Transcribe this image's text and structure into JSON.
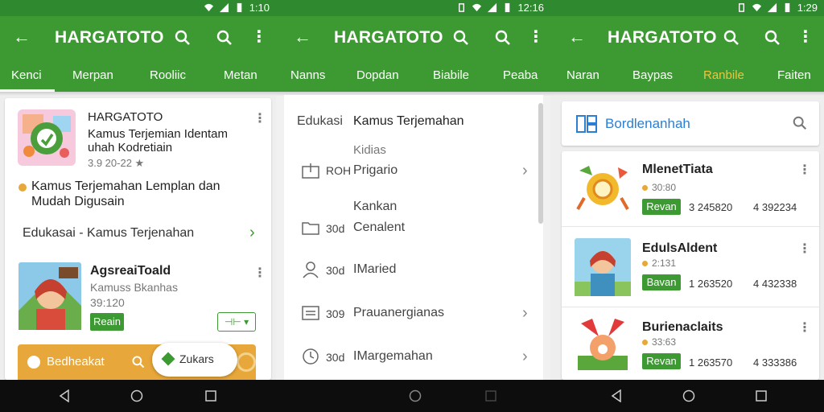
{
  "colors": {
    "appbar": "#3d9a32",
    "statusbar": "#2f8a2f",
    "accent_yellow": "#f2c23d",
    "orange": "#e8a73a"
  },
  "panel1": {
    "status_time": "1:10",
    "title": "HARGATOTO",
    "tabs": [
      "Kenci",
      "Merpan",
      "Rooliic",
      "Metan"
    ],
    "active_tab": 0,
    "app_card": {
      "app_name": "HARGATOTO",
      "desc_line1": "Kamus Terjemian Identam",
      "desc_line2": "uhah Kodretiain",
      "rating": "3.9 20-22 ★",
      "subtitle_line1": "Kamus Terjemahan Lemplan dan",
      "subtitle_line2": "Mudah Digusain",
      "category_link": "Edukasai - Kamus Terjenahan"
    },
    "second_app": {
      "name": "AgsreaiToald",
      "sub": "Kamuss Bkanhas",
      "meta": "39:120",
      "button": "Reain",
      "install_glyph": "⊣⊢ ▾"
    },
    "bottom_bar": {
      "left_label": "Bedheakat",
      "toast_label": "Zukars"
    }
  },
  "panel2": {
    "status_time": "12:16",
    "title": "HARGATOTO",
    "tabs": [
      "Nanns",
      "Dopdan",
      "Biabile",
      "Peaba"
    ],
    "header_left": "Edukasi",
    "header_right": "Kamus Terjemahan",
    "rows": [
      {
        "label_top": "Kidias",
        "code": "ROH",
        "name": "Prigario",
        "icon": "upload-icon",
        "chevron": true
      },
      {
        "label_top": "Kankan",
        "code": "30d",
        "name": "Cenalent",
        "icon": "folder-icon",
        "chevron": false
      },
      {
        "label_top": "",
        "code": "30d",
        "name": "IMaried",
        "icon": "person-icon",
        "chevron": false
      },
      {
        "label_top": "",
        "code": "309",
        "name": "Prauanergianas",
        "icon": "list-icon",
        "chevron": true
      },
      {
        "label_top": "",
        "code": "30d",
        "name": "IMargemahan",
        "icon": "clock-icon",
        "chevron": true
      }
    ]
  },
  "panel3": {
    "status_time": "1:29",
    "title": "HARGATOTO",
    "tabs": [
      "Naran",
      "Baypas",
      "Ranbile",
      "Faiten"
    ],
    "highlight_tab": 2,
    "search_placeholder": "Bordlenanhah",
    "apps": [
      {
        "name": "MlenetTiata",
        "rating": "30:80",
        "button": "Revan",
        "stat1": "3 245820",
        "stat2": "4 392234"
      },
      {
        "name": "EdulsAldent",
        "rating": "2:131",
        "button": "Bavan",
        "stat1": "1 263520",
        "stat2": "4 432338"
      },
      {
        "name": "Burienaclaits",
        "rating": "33:63",
        "button": "Revan",
        "stat1": "1 263570",
        "stat2": "4 333386"
      }
    ]
  }
}
